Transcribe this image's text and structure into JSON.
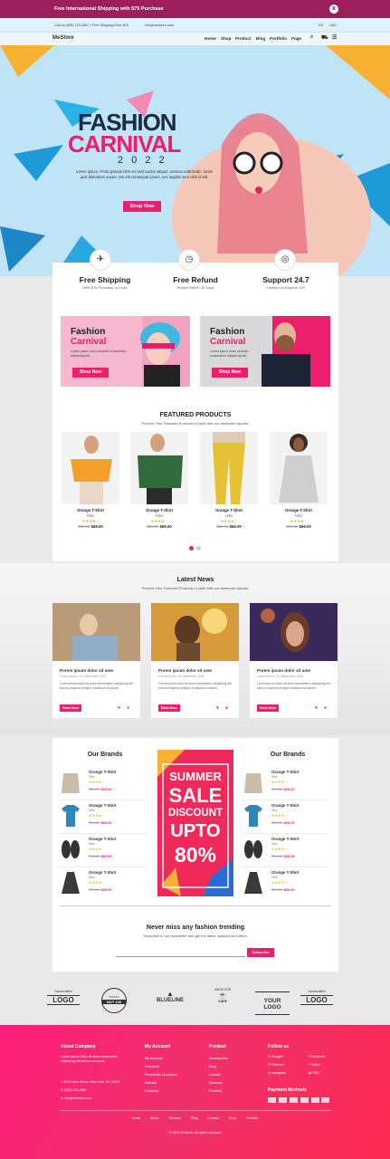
{
  "topbar": {
    "message": "Free International Shipping with $75 Purchase",
    "close": "x"
  },
  "infobar": {
    "left": "Call us (555) 123-4567  |  Free Shipping Over $75",
    "email": "info@mestore.com",
    "lang": "EN",
    "currency": "USD"
  },
  "nav": {
    "logo": "MeStore",
    "items": [
      "Home",
      "Shop",
      "Product",
      "Blog",
      "Portfolio",
      "Page"
    ]
  },
  "hero": {
    "title1": "FASHION",
    "title2": "CARNIVAL",
    "year": "2 0 2 2",
    "desc": "Lorem ipsum. Proin gravida nibh vel velit auctor aliquet. Aenean sollicitudin, lorem quis bibendum auctor, nisi elit consequat ipsum, nec sagittis sem nibh id elit.",
    "button": "Shop Now"
  },
  "features": [
    {
      "title": "Free Shipping",
      "text": "With $75 Purchase or more"
    },
    {
      "title": "Free Refund",
      "text": "Refund Within 30 Days"
    },
    {
      "title": "Support 24.7",
      "text": "Contact Us Anytime 24/7"
    }
  ],
  "banners": [
    {
      "t1": "Fashion",
      "t2": "Carnival",
      "text": "Lorem ipsum dolor sit amet consectetur adipiscing elit.",
      "btn": "Shop Now"
    },
    {
      "t1": "Fashion",
      "t2": "Carnival",
      "text": "Lorem ipsum dolor sit amet consectetur adipiscing elit.",
      "btn": "Shop Now"
    }
  ],
  "featured": {
    "title": "FEATURED PRODUCTS",
    "subtitle": "Present Your Featured Products in style with our awesome layouts.",
    "products": [
      {
        "name": "Orange T-Shirt",
        "cat": "Nike",
        "old": "$86.00",
        "price": "$69.00",
        "stars": "★★★★☆"
      },
      {
        "name": "Orange T-Shirt",
        "cat": "Nike",
        "old": "$86.00",
        "price": "$69.00",
        "stars": "★★★★☆"
      },
      {
        "name": "Orange T-Shirt",
        "cat": "Nike",
        "old": "$86.00",
        "price": "$69.00",
        "stars": "★★★★☆"
      },
      {
        "name": "Orange T-Shirt",
        "cat": "Nike",
        "old": "$86.00",
        "price": "$69.00",
        "stars": "★★★★☆"
      }
    ]
  },
  "news": {
    "title": "Latest News",
    "subtitle": "Present Your Featured Products in style with our awesome layouts.",
    "items": [
      {
        "title": "Porem ipsum dolor sit ame",
        "meta": "Lorem ipsum, 24 September 2022",
        "text": "Lorem ipsum dolor sit amet consectetur adipiscing elit sed do eiusmod tempor incididunt ut labore.",
        "btn": "Read More"
      },
      {
        "title": "Porem ipsum dolor sit ame",
        "meta": "Lorem ipsum, 24 September 2022",
        "text": "Lorem ipsum dolor sit amet consectetur adipiscing elit sed do eiusmod tempor incididunt ut labore.",
        "btn": "Read More"
      },
      {
        "title": "Porem ipsum dolor sit ame",
        "meta": "Lorem ipsum, 24 September 2022",
        "text": "Lorem ipsum dolor sit amet consectetur adipiscing elit sed do eiusmod tempor incididunt ut labore.",
        "btn": "Read More"
      }
    ]
  },
  "brands": {
    "title": "Our Brands",
    "items": [
      {
        "name": "Orange T-Shirt",
        "cat": "Nike",
        "old": "$74.00",
        "price": "$69.00",
        "stars": "★★★★☆"
      },
      {
        "name": "Orange T-Shirt",
        "cat": "Nike",
        "old": "$74.00",
        "price": "$69.00",
        "stars": "★★★★☆"
      },
      {
        "name": "Orange T-Shirt",
        "cat": "Nike",
        "old": "$74.00",
        "price": "$69.00",
        "stars": "★★★★☆"
      },
      {
        "name": "Orange T-Shirt",
        "cat": "Nike",
        "old": "$74.00",
        "price": "$69.00",
        "stars": "★★★★☆"
      }
    ],
    "sale": {
      "l1": "SUMMER",
      "l2": "SALE",
      "l3": "DISCOUNT",
      "l4": "UPTO",
      "l5": "80%"
    }
  },
  "newsletter": {
    "title": "Never miss any fashion trending",
    "text": "Subscribe to our newsletter and get the latest updates and offers.",
    "placeholder": "",
    "btn": "Subscribe"
  },
  "logos": [
    {
      "a": "Handcrafted",
      "b": "LOGO"
    },
    {
      "a": "STUDIO",
      "b": "NOT 100"
    },
    {
      "a": "",
      "b": "BLUELINE"
    },
    {
      "a": "JOHN DOE",
      "b": "CAFE"
    },
    {
      "a": "",
      "b": "YOUR LOGO"
    },
    {
      "a": "Handcrafted",
      "b": "LOGO"
    }
  ],
  "footer": {
    "about": {
      "title": "About Company",
      "text": "Lorem ipsum dolor sit amet consectetur adipiscing elit sed do eiusmod.",
      "address": "1234 Main Street, New York, NY 10001",
      "phone": "(555) 123-4567",
      "email": "info@mestore.com"
    },
    "account": {
      "title": "My Account",
      "items": [
        "My Account",
        "Checkout",
        "Frequently Questions",
        "Wishlist",
        "Contacts"
      ]
    },
    "product": {
      "title": "Product",
      "items": [
        "Accessories",
        "Blog",
        "Contact",
        "Services",
        "Portfolio"
      ]
    },
    "follow": {
      "title": "Follow us",
      "items": [
        "Google+",
        "Facebook",
        "Pinterest",
        "Twitter",
        "Instagram",
        "RSS"
      ]
    },
    "payment": "Payment Methods",
    "links": [
      "Home",
      "About",
      "Services",
      "Blog",
      "Contact",
      "Shop",
      "Portfolio"
    ],
    "copyright": "© 2022 MeStore. All rights reserved."
  },
  "colors": {
    "accent": "#ec1f6e",
    "topbar": "#9c1f5c",
    "hero": "#bfe4f6"
  }
}
